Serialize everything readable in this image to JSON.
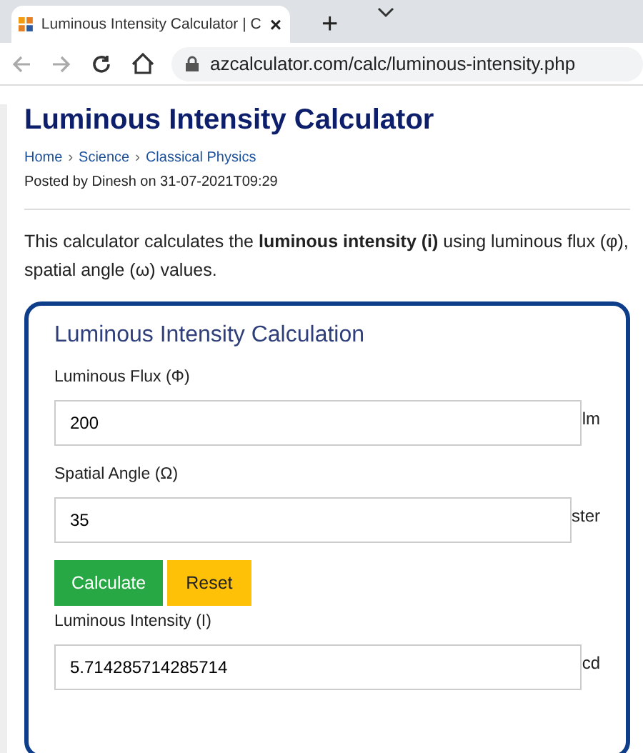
{
  "browser": {
    "tab_title": "Luminous Intensity Calculator | C",
    "tab_close": "×",
    "new_tab": "+",
    "url": "azcalculator.com/calc/luminous-intensity.php"
  },
  "page": {
    "title": "Luminous Intensity Calculator",
    "breadcrumbs": [
      "Home",
      "Science",
      "Classical Physics"
    ],
    "breadcrumb_separator": "›",
    "posted": "Posted by Dinesh on 31-07-2021T09:29",
    "intro": "This calculator calculates the **luminous intensity (i)** using luminous flux (φ), spatial angle (ω) values."
  },
  "calculator": {
    "title": "Luminous Intensity Calculation",
    "inputs": [
      {
        "label": "Luminous Flux (Φ)",
        "value": "200",
        "unit": "lm"
      },
      {
        "label": "Spatial Angle (Ω)",
        "value": "35",
        "unit": "ster"
      }
    ],
    "buttons": [
      {
        "label": "Calculate",
        "kind": "primary"
      },
      {
        "label": "Reset",
        "kind": "warning"
      }
    ],
    "result": {
      "label": "Luminous Intensity (I)",
      "value": "5.714285714285714",
      "unit": "cd"
    }
  }
}
